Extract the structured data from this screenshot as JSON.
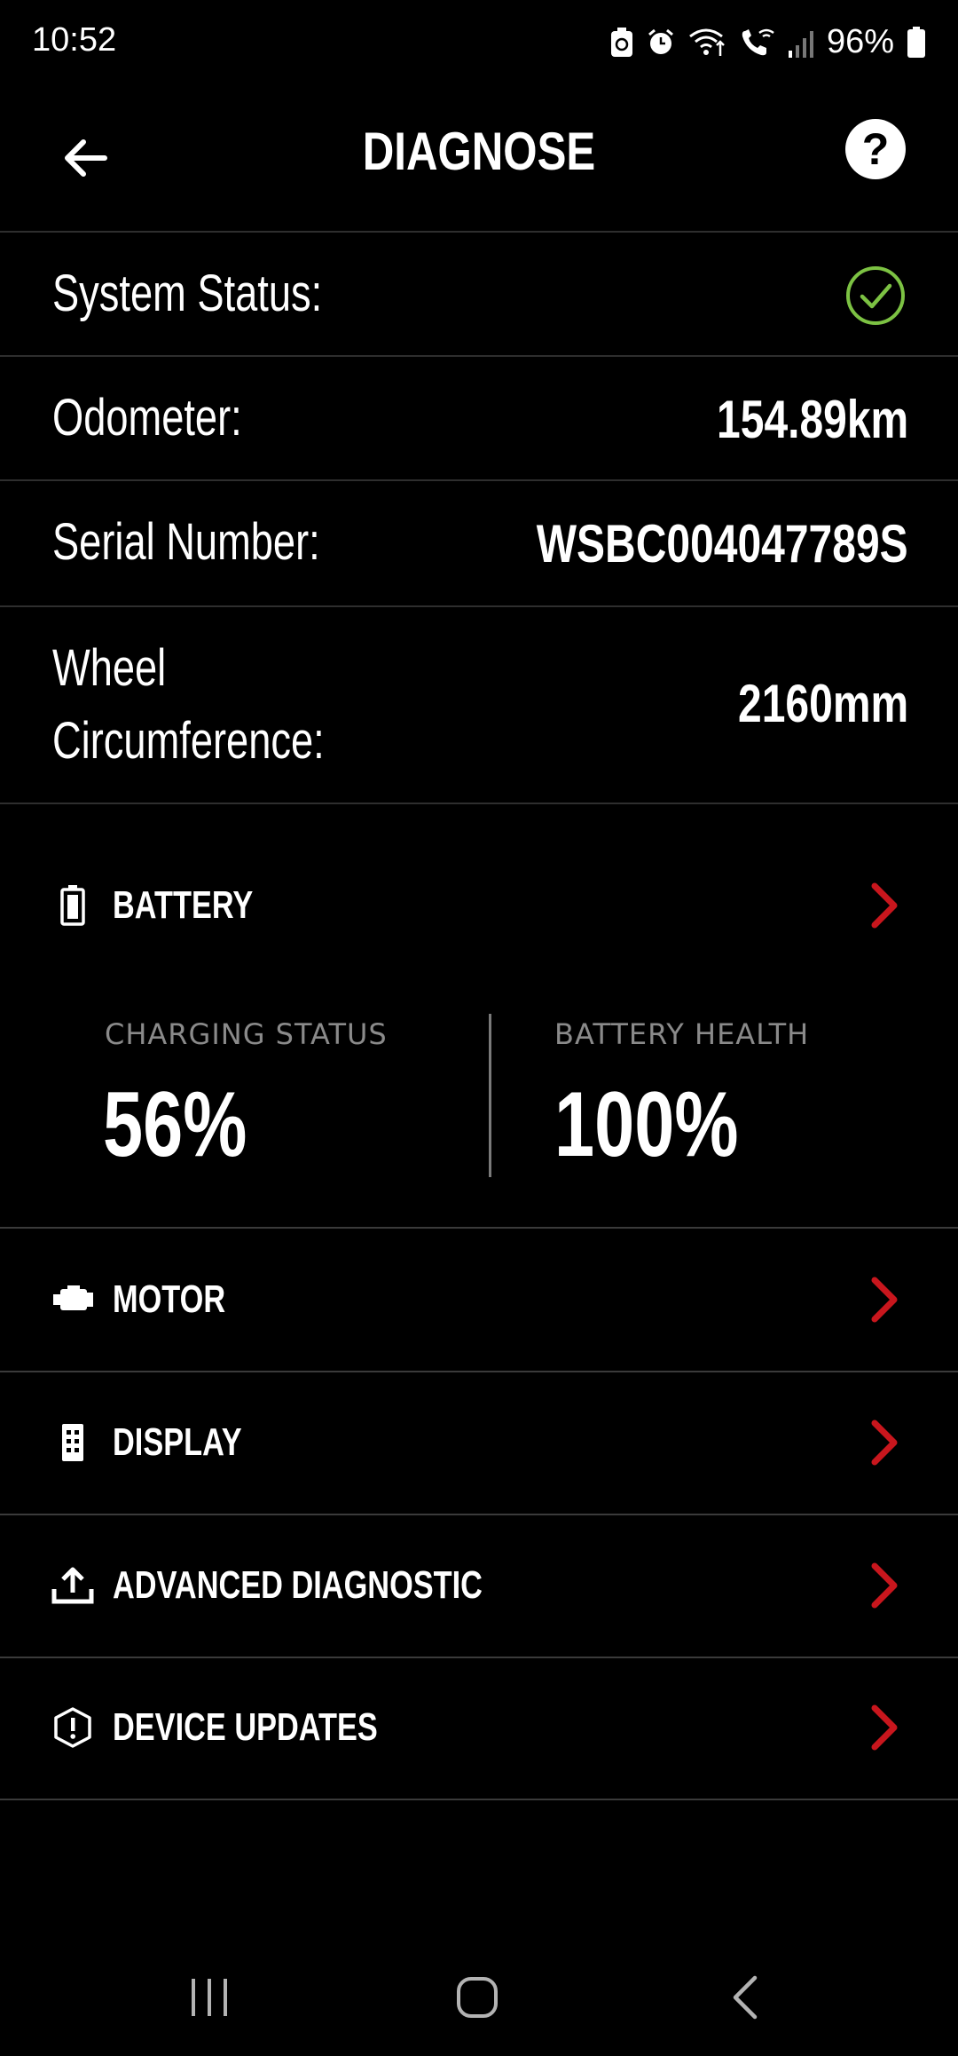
{
  "status_bar": {
    "time": "10:52",
    "battery_percent": "96%"
  },
  "header": {
    "title": "DIAGNOSE",
    "help_label": "?"
  },
  "info": {
    "system_status_label": "System Status:",
    "system_status_value": "ok",
    "odometer_label": "Odometer:",
    "odometer_value": "154.89km",
    "serial_label": "Serial Number:",
    "serial_value": "WSBC004047789S",
    "wheel_label_line1": "Wheel",
    "wheel_label_line2": "Circumference:",
    "wheel_value": "2160mm"
  },
  "battery": {
    "label": "BATTERY",
    "charging_status_label": "CHARGING STATUS",
    "charging_status_value": "56%",
    "battery_health_label": "BATTERY HEALTH",
    "battery_health_value": "100%"
  },
  "menu": {
    "motor": "MOTOR",
    "display": "DISPLAY",
    "advanced": "ADVANCED DIAGNOSTIC",
    "updates": "DEVICE UPDATES"
  },
  "colors": {
    "background": "#000000",
    "chevron": "#c8161d",
    "status_ok": "#7cc243",
    "divider": "#2e2e2e"
  }
}
